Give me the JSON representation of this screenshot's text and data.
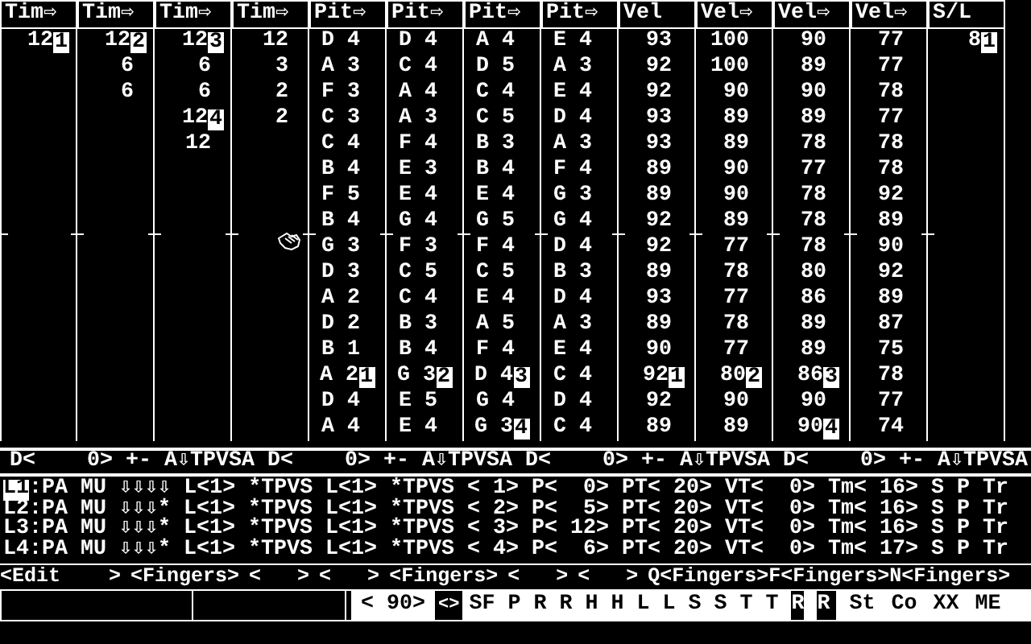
{
  "columns": [
    {
      "header": "Tim⇨",
      "kind": "time",
      "cells": [
        {
          "value": "12",
          "mark": "1"
        }
      ]
    },
    {
      "header": "Tim⇨",
      "kind": "time",
      "cells": [
        {
          "value": "12",
          "mark": "2"
        },
        {
          "value": "6"
        },
        {
          "value": "6"
        }
      ]
    },
    {
      "header": "Tim⇨",
      "kind": "time",
      "cells": [
        {
          "value": "12",
          "mark": "3"
        },
        {
          "value": "6"
        },
        {
          "value": "6"
        },
        {
          "value": "12",
          "mark": "4"
        },
        {
          "value": "12"
        }
      ]
    },
    {
      "header": "Tim⇨",
      "kind": "time",
      "cells": [
        {
          "value": "12"
        },
        {
          "value": "3"
        },
        {
          "value": "2"
        },
        {
          "value": "2"
        }
      ]
    },
    {
      "header": "Pit⇨",
      "kind": "pitch",
      "cells": [
        {
          "value": "D 4"
        },
        {
          "value": "A 3"
        },
        {
          "value": "F 3"
        },
        {
          "value": "C 3"
        },
        {
          "value": "C 4"
        },
        {
          "value": "B 4"
        },
        {
          "value": "F 5"
        },
        {
          "value": "B 4"
        },
        {
          "value": "G 3"
        },
        {
          "value": "D 3"
        },
        {
          "value": "A 2"
        },
        {
          "value": "D 2"
        },
        {
          "value": "B 1"
        },
        {
          "value": "A 2",
          "mark": "1"
        },
        {
          "value": "D 4"
        },
        {
          "value": "A 4"
        }
      ]
    },
    {
      "header": "Pit⇨",
      "kind": "pitch",
      "cells": [
        {
          "value": "D 4"
        },
        {
          "value": "C 4"
        },
        {
          "value": "A 4"
        },
        {
          "value": "A 3"
        },
        {
          "value": "F 4"
        },
        {
          "value": "E 3"
        },
        {
          "value": "E 4"
        },
        {
          "value": "G 4"
        },
        {
          "value": "F 3"
        },
        {
          "value": "C 5"
        },
        {
          "value": "C 4"
        },
        {
          "value": "B 3"
        },
        {
          "value": "B 4"
        },
        {
          "value": "G 3",
          "mark": "2"
        },
        {
          "value": "E 5"
        },
        {
          "value": "E 4"
        }
      ]
    },
    {
      "header": "Pit⇨",
      "kind": "pitch",
      "cells": [
        {
          "value": "A 4"
        },
        {
          "value": "D 5"
        },
        {
          "value": "C 4"
        },
        {
          "value": "C 5"
        },
        {
          "value": "B 3"
        },
        {
          "value": "B 4"
        },
        {
          "value": "E 4"
        },
        {
          "value": "G 5"
        },
        {
          "value": "F 4"
        },
        {
          "value": "C 5"
        },
        {
          "value": "E 4"
        },
        {
          "value": "A 5"
        },
        {
          "value": "F 4"
        },
        {
          "value": "D 4",
          "mark": "3"
        },
        {
          "value": "G 4"
        },
        {
          "value": "G 3",
          "mark": "4"
        }
      ]
    },
    {
      "header": "Pit⇨",
      "kind": "pitch",
      "cells": [
        {
          "value": "E 4"
        },
        {
          "value": "A 3"
        },
        {
          "value": "E 4"
        },
        {
          "value": "D 4"
        },
        {
          "value": "A 3"
        },
        {
          "value": "F 4"
        },
        {
          "value": "G 3"
        },
        {
          "value": "G 4"
        },
        {
          "value": "D 4"
        },
        {
          "value": "B 3"
        },
        {
          "value": "D 4"
        },
        {
          "value": "A 3"
        },
        {
          "value": "E 4"
        },
        {
          "value": "C 4"
        },
        {
          "value": "D 4"
        },
        {
          "value": "C 4"
        }
      ]
    },
    {
      "header": "Vel",
      "kind": "velocity",
      "cells": [
        {
          "value": "93"
        },
        {
          "value": "92"
        },
        {
          "value": "92"
        },
        {
          "value": "93"
        },
        {
          "value": "93"
        },
        {
          "value": "89"
        },
        {
          "value": "89"
        },
        {
          "value": "92"
        },
        {
          "value": "92"
        },
        {
          "value": "89"
        },
        {
          "value": "93"
        },
        {
          "value": "89"
        },
        {
          "value": "90"
        },
        {
          "value": "92",
          "mark": "1"
        },
        {
          "value": "92"
        },
        {
          "value": "89"
        }
      ]
    },
    {
      "header": "Vel⇨",
      "kind": "velocity",
      "cells": [
        {
          "value": "100"
        },
        {
          "value": "100"
        },
        {
          "value": "90"
        },
        {
          "value": "89"
        },
        {
          "value": "89"
        },
        {
          "value": "90"
        },
        {
          "value": "90"
        },
        {
          "value": "89"
        },
        {
          "value": "77"
        },
        {
          "value": "78"
        },
        {
          "value": "77"
        },
        {
          "value": "78"
        },
        {
          "value": "77"
        },
        {
          "value": "80",
          "mark": "2"
        },
        {
          "value": "90"
        },
        {
          "value": "89"
        }
      ]
    },
    {
      "header": "Vel⇨",
      "kind": "velocity",
      "cells": [
        {
          "value": "90"
        },
        {
          "value": "89"
        },
        {
          "value": "90"
        },
        {
          "value": "89"
        },
        {
          "value": "78"
        },
        {
          "value": "77"
        },
        {
          "value": "78"
        },
        {
          "value": "78"
        },
        {
          "value": "78"
        },
        {
          "value": "80"
        },
        {
          "value": "86"
        },
        {
          "value": "89"
        },
        {
          "value": "89"
        },
        {
          "value": "86",
          "mark": "3"
        },
        {
          "value": "90"
        },
        {
          "value": "90",
          "mark": "4"
        }
      ]
    },
    {
      "header": "Vel⇨",
      "kind": "velocity",
      "cells": [
        {
          "value": "77"
        },
        {
          "value": "77"
        },
        {
          "value": "78"
        },
        {
          "value": "77"
        },
        {
          "value": "78"
        },
        {
          "value": "78"
        },
        {
          "value": "92"
        },
        {
          "value": "89"
        },
        {
          "value": "90"
        },
        {
          "value": "92"
        },
        {
          "value": "89"
        },
        {
          "value": "87"
        },
        {
          "value": "75"
        },
        {
          "value": "78"
        },
        {
          "value": "77"
        },
        {
          "value": "74"
        }
      ]
    },
    {
      "header": "S/L",
      "kind": "time",
      "cells": [
        {
          "value": "8",
          "mark": "1"
        }
      ]
    }
  ],
  "channel_headers": [
    "D<    0> +- A⇩TPVSA",
    "D<    0> +- A⇩TPVSA",
    "D<    0> +- A⇩TPVSA",
    "D<    0> +- A⇩TPVSA"
  ],
  "layers": [
    {
      "label": "L1",
      "selected": true,
      "text": ":PA MU ⇩⇩⇩⇩ L<1> *TPVS L<1> *TPVS < 1> P<  0> PT< 20> VT<  0> Tm< 16> S P Tr"
    },
    {
      "label": "L2",
      "selected": false,
      "text": ":PA MU ⇩⇩⇩* L<1> *TPVS L<1> *TPVS < 2> P<  5> PT< 20> VT<  0> Tm< 16> S P Tr"
    },
    {
      "label": "L3",
      "selected": false,
      "text": ":PA MU ⇩⇩⇩* L<1> *TPVS L<1> *TPVS < 3> P< 12> PT< 20> VT<  0> Tm< 16> S P Tr"
    },
    {
      "label": "L4",
      "selected": false,
      "text": ":PA MU ⇩⇩⇩* L<1> *TPVS L<1> *TPVS < 4> P<  6> PT< 20> VT<  0> Tm< 17> S P Tr"
    }
  ],
  "menu": [
    "<Edit    >",
    "<Fingers>",
    "<   >",
    "<   >",
    "<Fingers>",
    "<   >",
    "<   >",
    "Q<Fingers>",
    "F<Fingers>",
    "N<Fingers>"
  ],
  "status_bar": {
    "value": "< 90>",
    "toggle": "<>",
    "flags": [
      {
        "label": "SF",
        "on": true
      },
      {
        "label": "P",
        "on": true
      },
      {
        "label": "R",
        "on": true
      },
      {
        "label": "R",
        "on": true
      },
      {
        "label": "H",
        "on": true
      },
      {
        "label": "H",
        "on": true
      },
      {
        "label": "L",
        "on": true
      },
      {
        "label": "L",
        "on": true
      },
      {
        "label": "S",
        "on": true
      },
      {
        "label": "S",
        "on": true
      },
      {
        "label": "T",
        "on": true
      },
      {
        "label": "T",
        "on": true
      },
      {
        "label": "R",
        "on": false
      },
      {
        "label": "R",
        "on": false
      }
    ],
    "modes": [
      "St",
      "Co",
      "XX",
      "ME"
    ]
  }
}
